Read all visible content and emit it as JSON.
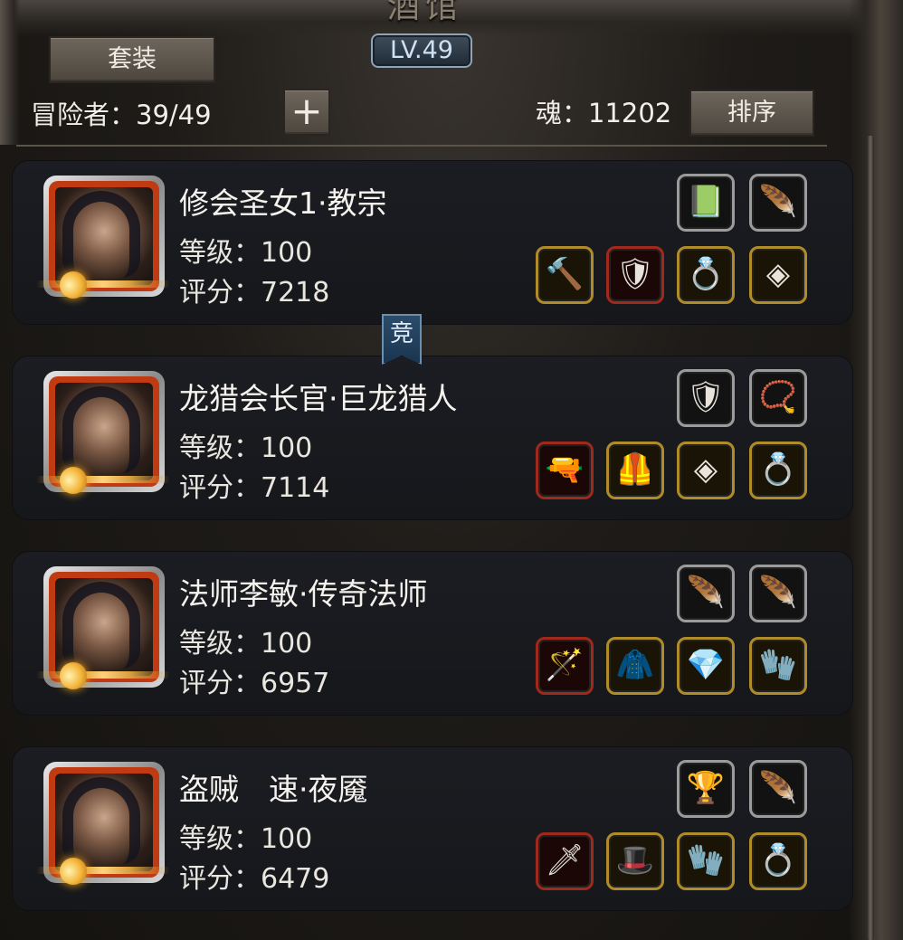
{
  "header": {
    "title": "酒馆",
    "level": "LV.49",
    "suit_button": "套装",
    "adventurer_label": "冒险者：39/49",
    "plus_button": "+",
    "soul_label": "魂：11202",
    "sort_button": "排序"
  },
  "rank_tag": "竞",
  "heroes": [
    {
      "name": "修会圣女1·教宗",
      "level": "等级：100",
      "score": "评分：7218",
      "slots_top": [
        {
          "icon": "green-book-icon",
          "glyph": "📗",
          "frame": "silver"
        },
        {
          "icon": "feather-icon",
          "glyph": "🪶",
          "frame": "silver"
        }
      ],
      "slots_bottom": [
        {
          "icon": "hammer-icon",
          "glyph": "🔨",
          "frame": "gold"
        },
        {
          "icon": "armor-icon",
          "glyph": "🛡",
          "frame": "red"
        },
        {
          "icon": "amulet-icon",
          "glyph": "💍",
          "frame": "gold"
        },
        {
          "icon": "rune-icon",
          "glyph": "◈",
          "frame": "gold"
        }
      ]
    },
    {
      "name": "龙猎会长官·巨龙猎人",
      "level": "等级：100",
      "score": "评分：7114",
      "slots_top": [
        {
          "icon": "crest-icon",
          "glyph": "🛡",
          "frame": "silver"
        },
        {
          "icon": "necklace-icon",
          "glyph": "📿",
          "frame": "silver"
        }
      ],
      "slots_bottom": [
        {
          "icon": "revolver-icon",
          "glyph": "🔫",
          "frame": "red"
        },
        {
          "icon": "chest-armor-icon",
          "glyph": "🦺",
          "frame": "gold"
        },
        {
          "icon": "rune-icon",
          "glyph": "◈",
          "frame": "gold"
        },
        {
          "icon": "ring-icon",
          "glyph": "💍",
          "frame": "gold"
        }
      ]
    },
    {
      "name": "法师李敏·传奇法师",
      "level": "等级：100",
      "score": "评分：6957",
      "slots_top": [
        {
          "icon": "feather-icon",
          "glyph": "🪶",
          "frame": "silver"
        },
        {
          "icon": "feather-icon",
          "glyph": "🪶",
          "frame": "silver"
        }
      ],
      "slots_bottom": [
        {
          "icon": "staff-icon",
          "glyph": "🪄",
          "frame": "red"
        },
        {
          "icon": "robe-icon",
          "glyph": "🧥",
          "frame": "gold"
        },
        {
          "icon": "gem-icon",
          "glyph": "💎",
          "frame": "gold"
        },
        {
          "icon": "gauntlet-icon",
          "glyph": "🧤",
          "frame": "gold"
        }
      ]
    },
    {
      "name": "盗贼　速·夜魇",
      "level": "等级：100",
      "score": "评分：6479",
      "slots_top": [
        {
          "icon": "trophy-icon",
          "glyph": "🏆",
          "frame": "silver"
        },
        {
          "icon": "claw-icon",
          "glyph": "🪶",
          "frame": "silver"
        }
      ],
      "slots_bottom": [
        {
          "icon": "dagger-icon",
          "glyph": "🗡",
          "frame": "red"
        },
        {
          "icon": "hood-icon",
          "glyph": "🎩",
          "frame": "gold"
        },
        {
          "icon": "gauntlet-icon",
          "glyph": "🧤",
          "frame": "gold"
        },
        {
          "icon": "ring-icon",
          "glyph": "💍",
          "frame": "gold"
        }
      ]
    }
  ]
}
